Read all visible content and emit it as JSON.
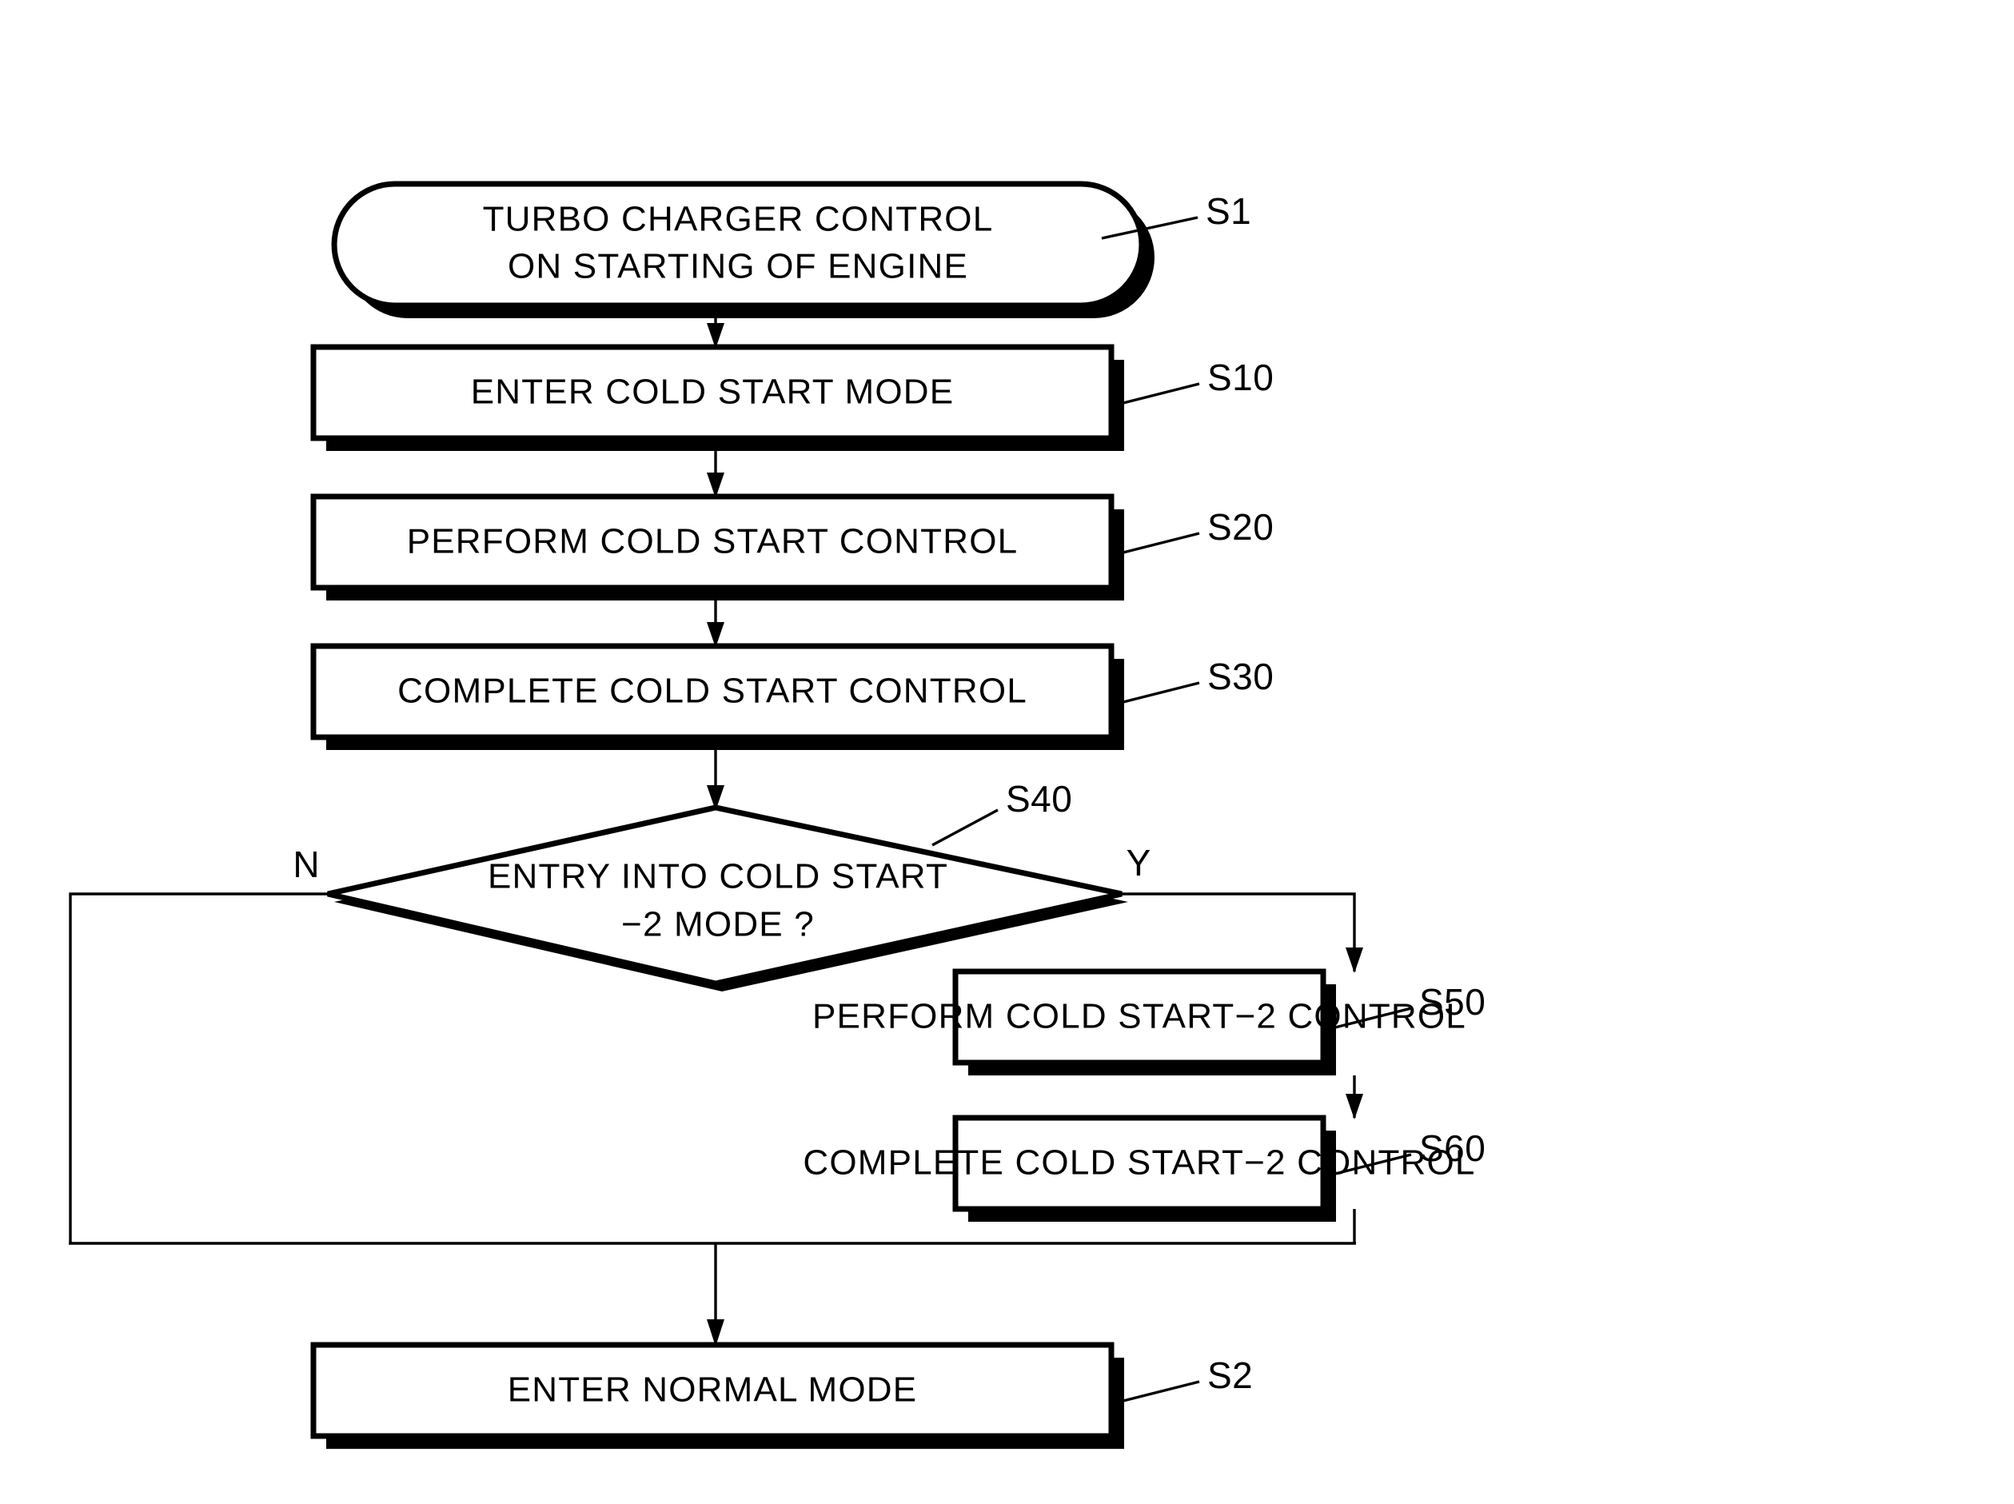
{
  "diagram": {
    "type": "flowchart",
    "title": "TURBO CHARGER CONTROL ON STARTING OF ENGINE",
    "orientation": "top-to-bottom",
    "background_color": "#ffffff",
    "line_color": "#000000"
  },
  "nodes": {
    "start": {
      "shape": "terminator",
      "line1": "TURBO CHARGER CONTROL",
      "line2": "ON STARTING OF ENGINE",
      "ref": "S1"
    },
    "step_s10": {
      "shape": "process",
      "label": "ENTER COLD START MODE",
      "ref": "S10"
    },
    "step_s20": {
      "shape": "process",
      "label": "PERFORM COLD START CONTROL",
      "ref": "S20"
    },
    "step_s30": {
      "shape": "process",
      "label": "COMPLETE COLD START CONTROL",
      "ref": "S30"
    },
    "decision_s40": {
      "shape": "decision",
      "line1": "ENTRY INTO COLD START",
      "line2": "−2 MODE ?",
      "ref": "S40",
      "branch_no": "N",
      "branch_yes": "Y"
    },
    "step_s50": {
      "shape": "process",
      "label": "PERFORM COLD START−2 CONTROL",
      "ref": "S50"
    },
    "step_s60": {
      "shape": "process",
      "label": "COMPLETE COLD START−2 CONTROL",
      "ref": "S60"
    },
    "end_s2": {
      "shape": "process",
      "label": "ENTER NORMAL MODE",
      "ref": "S2"
    }
  },
  "edges": [
    {
      "from": "start",
      "to": "step_s10",
      "label": ""
    },
    {
      "from": "step_s10",
      "to": "step_s20",
      "label": ""
    },
    {
      "from": "step_s20",
      "to": "step_s30",
      "label": ""
    },
    {
      "from": "step_s30",
      "to": "decision_s40",
      "label": ""
    },
    {
      "from": "decision_s40",
      "to": "step_s50",
      "label": "Y"
    },
    {
      "from": "decision_s40",
      "to": "end_s2",
      "label": "N"
    },
    {
      "from": "step_s50",
      "to": "step_s60",
      "label": ""
    },
    {
      "from": "step_s60",
      "to": "end_s2",
      "label": ""
    }
  ]
}
